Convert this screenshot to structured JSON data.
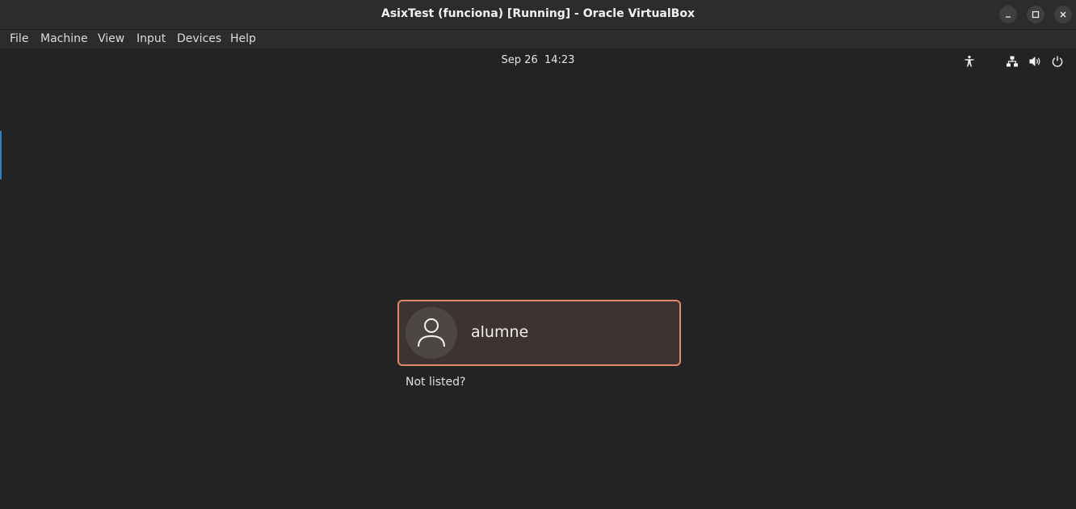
{
  "window": {
    "title": "AsixTest (funciona) [Running] - Oracle VirtualBox"
  },
  "window_controls": {
    "minimize_icon": "minimize-icon",
    "maximize_icon": "maximize-icon",
    "close_icon": "close-icon"
  },
  "menubar": {
    "items": [
      {
        "label": "File"
      },
      {
        "label": "Machine"
      },
      {
        "label": "View"
      },
      {
        "label": "Input"
      },
      {
        "label": "Devices"
      },
      {
        "label": "Help"
      }
    ]
  },
  "top_panel": {
    "clock": "Sep 26  14:23",
    "tray_icons": [
      "accessibility-icon",
      "network-icon",
      "volume-icon",
      "power-icon"
    ]
  },
  "login": {
    "user": {
      "name": "alumne",
      "avatar_icon": "user-icon"
    },
    "not_listed": "Not listed?"
  },
  "colors": {
    "background": "#242424",
    "card_border": "#e4866a",
    "card_background": "#3d3331",
    "accent": "#2d7fc1"
  }
}
